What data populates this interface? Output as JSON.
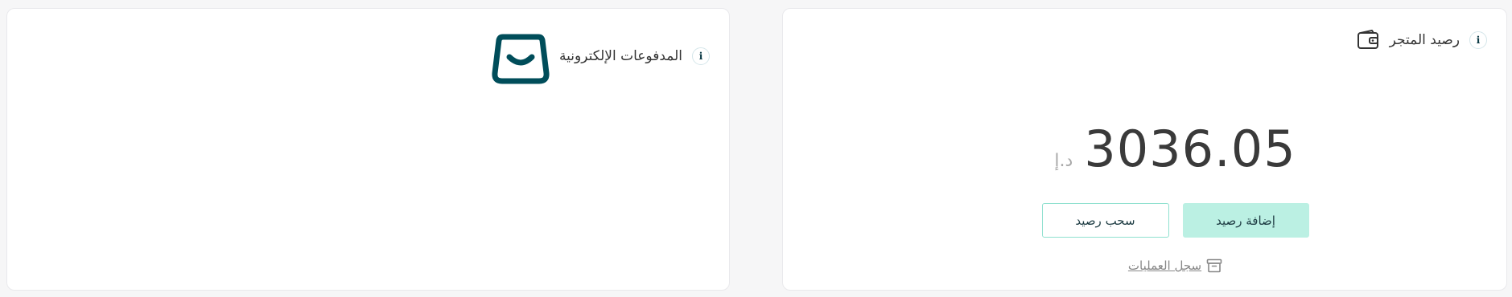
{
  "store_balance": {
    "title": "رصيد المتجر",
    "amount": "3036.05",
    "currency": "د.إ",
    "add_label": "إضافة رصيد",
    "withdraw_label": "سحب رصيد",
    "history_label": "سجل العمليات",
    "info_glyph": "i",
    "icon": "wallet-icon"
  },
  "e_payments": {
    "title": "المدفوعات الإلكترونية",
    "info_glyph": "i",
    "icon": "store-logo"
  },
  "colors": {
    "page_bg": "#f6f6f7",
    "card_bg": "#ffffff",
    "primary_dark": "#004d5a",
    "accent_mint": "#bbf0e3",
    "accent_border": "#8fe0cf"
  }
}
